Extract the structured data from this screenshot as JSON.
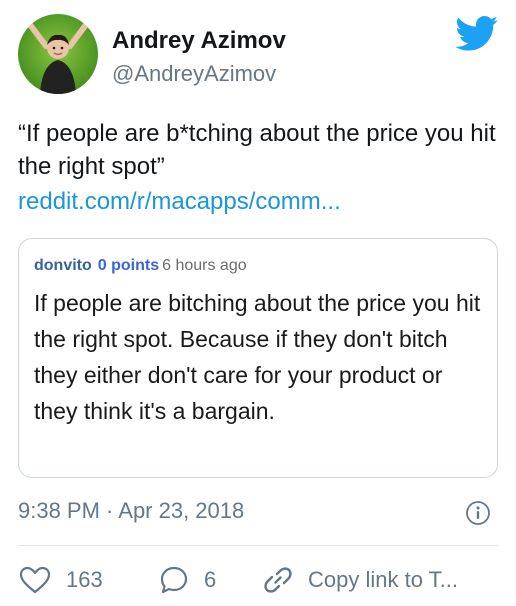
{
  "author": {
    "display_name": "Andrey Azimov",
    "handle": "@AndreyAzimov"
  },
  "brand": {
    "accent_color": "#1da1f2",
    "link_color": "#1b95e0",
    "logo_icon": "twitter-bird-icon"
  },
  "tweet": {
    "text": "“If people are b*tching about the price you hit the right spot”",
    "link_text": "reddit.com/r/macapps/comm..."
  },
  "embed": {
    "username": "donvito",
    "points": "0 points",
    "age": "6 hours ago",
    "body": "If people are bitching about the price you hit the right spot. Because if they don't bitch they either don't care for your product or they think it's a bargain."
  },
  "meta": {
    "timestamp": "9:38 PM · Apr 23, 2018",
    "info_icon": "info-icon"
  },
  "actions": {
    "like_count": "163",
    "reply_count": "6",
    "share_label": "Copy link to T..."
  }
}
